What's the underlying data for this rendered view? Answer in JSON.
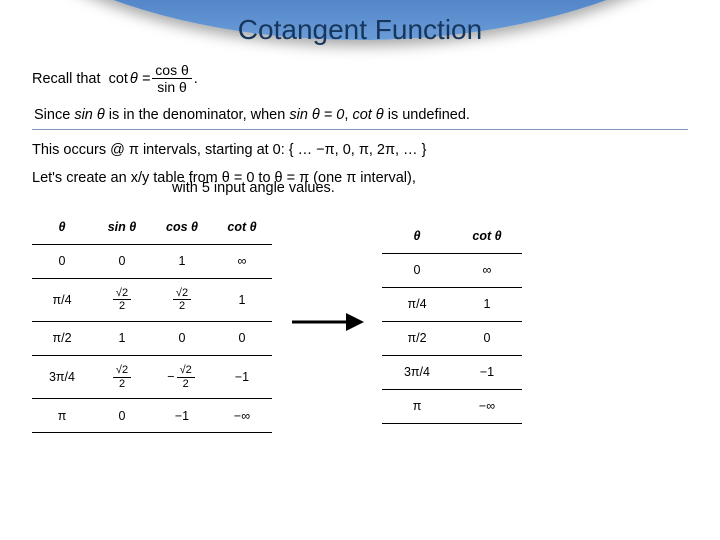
{
  "title": "Cotangent Function",
  "recall_prefix": "Recall that",
  "recall_cot": "cot",
  "recall_eq": "θ =",
  "recall_frac_num": "cos θ",
  "recall_frac_den": "sin θ",
  "recall_period": ".",
  "para1_a": "Since ",
  "para1_b": "sin θ",
  "para1_c": " is in the denominator, when ",
  "para1_d": "sin θ = 0",
  "para1_e": ", ",
  "para1_f": "cot θ",
  "para1_g": " is undefined.",
  "para2": "This occurs @ π intervals, starting at 0:  { … −π, 0, π, 2π, … }",
  "para3": "Let's create an x/y table from θ = 0 to θ = π  (one π interval),",
  "para3b": "with 5 input angle values.",
  "table_left": {
    "headers": [
      "θ",
      "sin θ",
      "cos θ",
      "cot θ"
    ],
    "rows": [
      {
        "theta": "0",
        "sin": "0",
        "cos": "1",
        "cot": "∞",
        "sin_frac": false,
        "cos_frac": false
      },
      {
        "theta": "π/4",
        "sin_num": "√2",
        "sin_den": "2",
        "cos_num": "√2",
        "cos_den": "2",
        "cot": "1",
        "sin_frac": true,
        "cos_frac": true
      },
      {
        "theta": "π/2",
        "sin": "1",
        "cos": "0",
        "cot": "0",
        "sin_frac": false,
        "cos_frac": false
      },
      {
        "theta": "3π/4",
        "sin_num": "√2",
        "sin_den": "2",
        "cos_num": "√2",
        "cos_den": "2",
        "cos_neg": "−",
        "cot": "−1",
        "sin_frac": true,
        "cos_frac": true
      },
      {
        "theta": "π",
        "sin": "0",
        "cos": "−1",
        "cot": "−∞",
        "sin_frac": false,
        "cos_frac": false
      }
    ]
  },
  "table_right": {
    "headers": [
      "θ",
      "cot θ"
    ],
    "rows": [
      {
        "theta": "0",
        "cot": "∞"
      },
      {
        "theta": "π/4",
        "cot": "1"
      },
      {
        "theta": "π/2",
        "cot": "0"
      },
      {
        "theta": "3π/4",
        "cot": "−1"
      },
      {
        "theta": "π",
        "cot": "−∞"
      }
    ]
  },
  "colors": {
    "title": "#17365d",
    "rule": "#7f99b8"
  }
}
